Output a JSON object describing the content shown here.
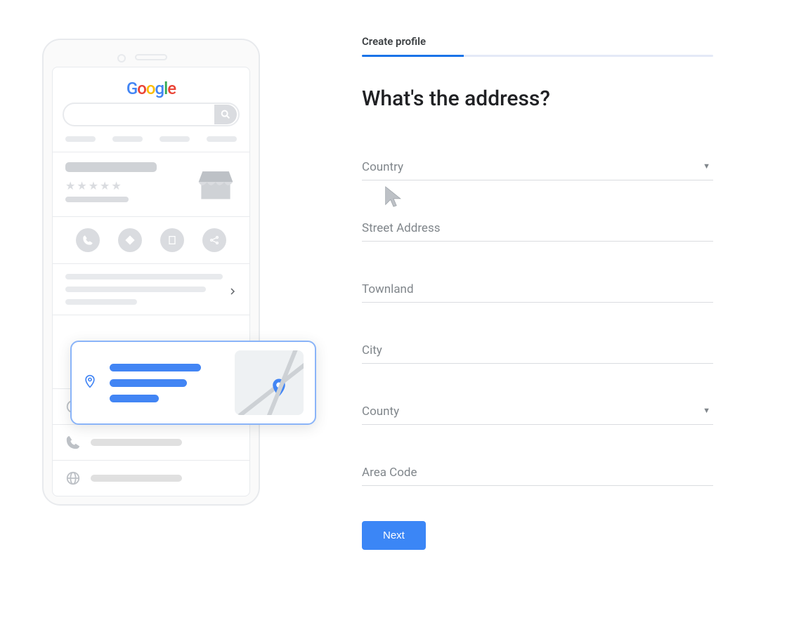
{
  "step": {
    "label": "Create profile",
    "progress_percent": 29
  },
  "heading": "What's the address?",
  "fields": {
    "country": {
      "label": "Country",
      "has_dropdown": true
    },
    "street": {
      "label": "Street Address",
      "has_dropdown": false
    },
    "townland": {
      "label": "Townland",
      "has_dropdown": false
    },
    "city": {
      "label": "City",
      "has_dropdown": false
    },
    "county": {
      "label": "County",
      "has_dropdown": true
    },
    "areacode": {
      "label": "Area Code",
      "has_dropdown": false
    }
  },
  "next_button": "Next",
  "illustration": {
    "logo_letters": [
      "G",
      "o",
      "o",
      "g",
      "l",
      "e"
    ],
    "icons": {
      "search": "search-icon",
      "phone": "phone-icon",
      "direction": "direction-icon",
      "save": "save-icon",
      "share": "share-icon",
      "clock": "clock-icon",
      "call": "call-icon",
      "globe": "globe-icon",
      "storefront": "storefront-icon",
      "pin": "pin-icon",
      "chevron": "chevron-right-icon",
      "cursor": "cursor-icon"
    }
  }
}
